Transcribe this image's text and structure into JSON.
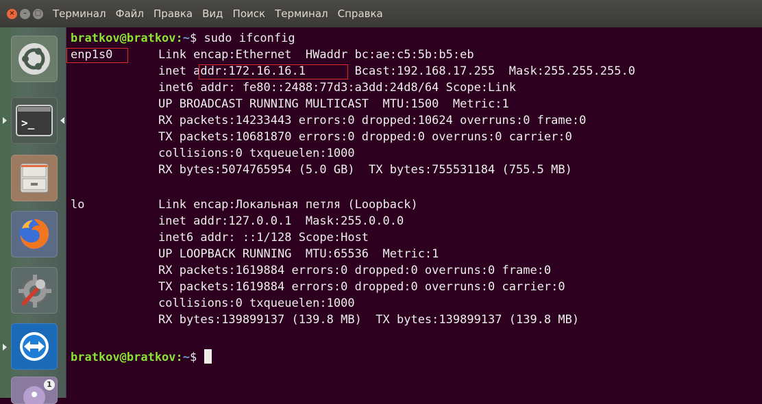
{
  "window": {
    "close_glyph": "×",
    "min_glyph": "–",
    "max_glyph": "□"
  },
  "menu": [
    "Терминал",
    "Файл",
    "Правка",
    "Вид",
    "Поиск",
    "Терминал",
    "Справка"
  ],
  "launcher": {
    "items": [
      {
        "name": "dash-home",
        "icon": "ubuntu-logo-icon"
      },
      {
        "name": "terminal",
        "icon": "terminal-icon"
      },
      {
        "name": "files",
        "icon": "file-cabinet-icon"
      },
      {
        "name": "firefox",
        "icon": "firefox-icon"
      },
      {
        "name": "system-settings",
        "icon": "wrench-gear-icon"
      },
      {
        "name": "teamviewer",
        "icon": "teamviewer-icon"
      },
      {
        "name": "pidgin",
        "icon": "pidgin-icon"
      }
    ],
    "badge_count": "1"
  },
  "colors": {
    "background": "#2c001e",
    "prompt_user": "#8ae234",
    "prompt_path": "#729fcf",
    "text": "#eeeeec",
    "highlight": "#e02a2a"
  },
  "terminal": {
    "prompt_user_host": "bratkov@bratkov",
    "prompt_sep": ":",
    "prompt_path": "~",
    "prompt_symbol": "$",
    "command": "sudo ifconfig",
    "interfaces": [
      {
        "name": "enp1s0",
        "lines": [
          "Link encap:Ethernet  HWaddr bc:ae:c5:5b:b5:eb",
          "inet addr:172.16.16.1       Bcast:192.168.17.255  Mask:255.255.255.0",
          "inet6 addr: fe80::2488:77d3:a3dd:24d8/64 Scope:Link",
          "UP BROADCAST RUNNING MULTICAST  MTU:1500  Metric:1",
          "RX packets:14233443 errors:0 dropped:10624 overruns:0 frame:0",
          "TX packets:10681870 errors:0 dropped:0 overruns:0 carrier:0",
          "collisions:0 txqueuelen:1000",
          "RX bytes:5074765954 (5.0 GB)  TX bytes:755531184 (755.5 MB)"
        ]
      },
      {
        "name": "lo",
        "lines": [
          "Link encap:Локальная петля (Loopback)",
          "inet addr:127.0.0.1  Mask:255.0.0.0",
          "inet6 addr: ::1/128 Scope:Host",
          "UP LOOPBACK RUNNING  MTU:65536  Metric:1",
          "RX packets:1619884 errors:0 dropped:0 overruns:0 frame:0",
          "TX packets:1619884 errors:0 dropped:0 overruns:0 carrier:0",
          "collisions:0 txqueuelen:1000",
          "RX bytes:139899137 (139.8 MB)  TX bytes:139899137 (139.8 MB)"
        ]
      }
    ]
  }
}
